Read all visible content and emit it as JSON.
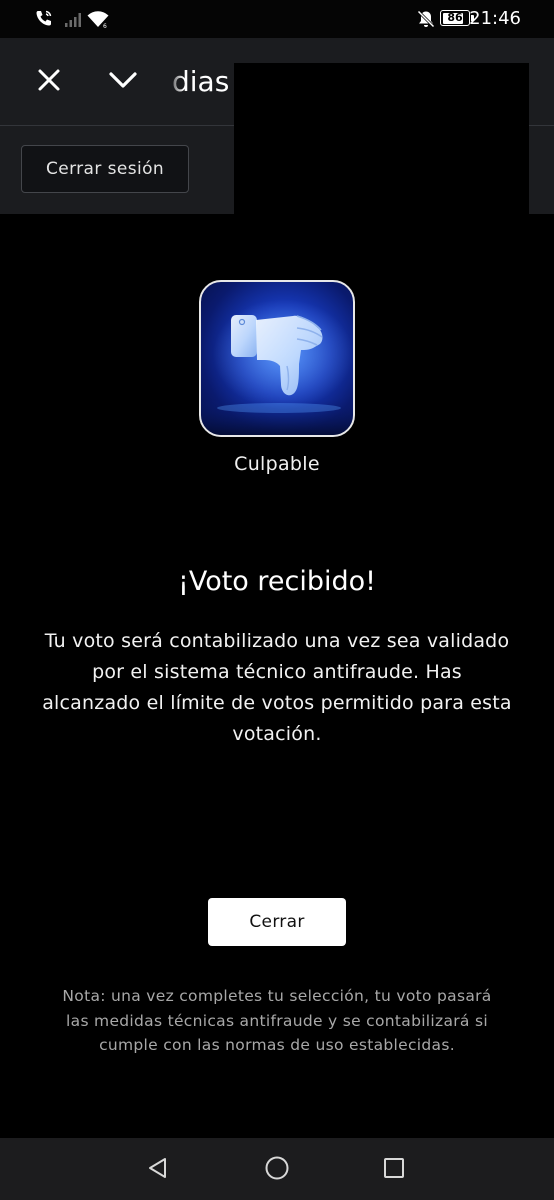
{
  "status_bar": {
    "time": "21:46",
    "battery_level": "86",
    "battery_fraction": 0.86,
    "icons": [
      "wifi-calling-icon",
      "signal-icon",
      "wifi-icon",
      "mute-icon",
      "battery-icon"
    ]
  },
  "header": {
    "title_visible": "dias",
    "close_icon": "close-icon",
    "collapse_icon": "chevron-down-icon",
    "logout_label": "Cerrar sesión"
  },
  "vote": {
    "option_label": "Culpable",
    "option_icon": "thumbs-down-icon",
    "title": "¡Voto recibido!",
    "message": "Tu voto será contabilizado una vez sea validado por el sistema técnico antifraude. Has alcanzado el límite de votos permitido para esta votación.",
    "close_label": "Cerrar",
    "footnote": "Nota: una vez completes tu selección, tu voto pasará las medidas técnicas antifraude y se contabilizará si cumple con las normas de uso establecidas."
  },
  "nav_bar": {
    "icons": [
      "back-triangle-icon",
      "home-circle-icon",
      "recents-square-icon"
    ]
  },
  "colors": {
    "background": "#000000",
    "header_background": "#1b1c1f",
    "primary_button": "#ffffff",
    "card_blue": "#1638b8",
    "footnote_text": "#a8a8a8"
  }
}
